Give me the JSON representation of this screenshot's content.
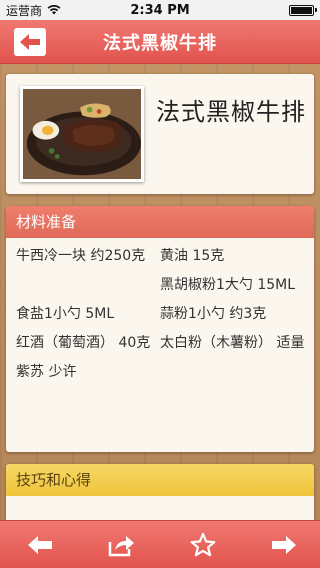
{
  "status_bar": {
    "carrier": "运营商",
    "time": "2:34 PM",
    "wifi_icon": "wifi-icon",
    "battery_icon": "battery-full-icon"
  },
  "nav": {
    "title": "法式黑椒牛排",
    "back_icon": "back-arrow-icon"
  },
  "recipe": {
    "name": "法式黑椒牛排",
    "image": "steak-on-sizzling-plate"
  },
  "ingredients": {
    "header": "材料准备",
    "items": [
      "牛西冷一块 约250克",
      "黄油 15克",
      "黑胡椒粉1大勺 15ML",
      "食盐1小勺 5ML",
      "蒜粉1小勺 约3克",
      "红酒（葡萄酒） 40克",
      "太白粉（木薯粉） 适量",
      "紫苏 少许"
    ]
  },
  "tips": {
    "header": "技巧和心得"
  },
  "toolbar": {
    "icons": [
      "left-arrow-icon",
      "share-icon",
      "star-icon",
      "right-arrow-icon"
    ]
  },
  "colors": {
    "accent_red": "#e2534d",
    "ingredient_header": "#e06a58",
    "tips_header": "#efc43c",
    "card_bg": "#fbf7ef",
    "wood_bg": "#b98b5c"
  }
}
